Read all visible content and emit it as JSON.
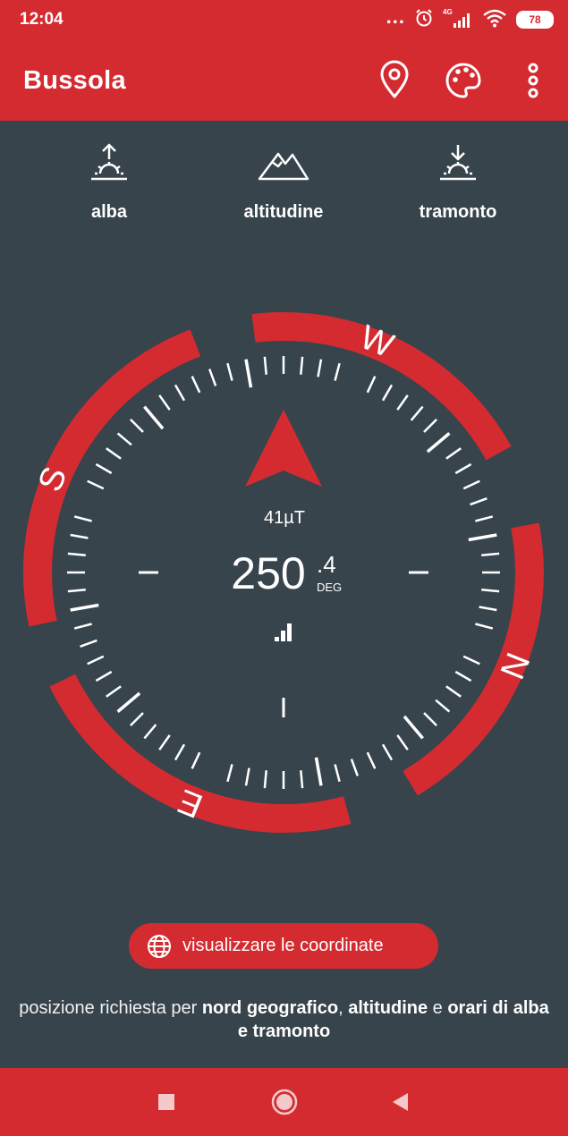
{
  "status_bar": {
    "time": "12:04",
    "network": "4G",
    "battery": "78",
    "icons": [
      "more-dots-icon",
      "alarm-icon",
      "signal-4g-icon",
      "wifi-icon",
      "battery-icon"
    ]
  },
  "app_bar": {
    "title": "Bussola",
    "actions": [
      "location-pin-icon",
      "palette-icon",
      "more-vert-icon"
    ]
  },
  "info_row": [
    {
      "label": "alba",
      "icon": "sunrise-icon"
    },
    {
      "label": "altitudine",
      "icon": "mountain-icon"
    },
    {
      "label": "tramonto",
      "icon": "sunset-icon"
    }
  ],
  "compass": {
    "heading": "250",
    "heading_decimal": ".4",
    "unit": "DEG",
    "field_strength": "41µT",
    "directions": {
      "north": "N",
      "south": "S",
      "east": "E",
      "west": "W"
    },
    "accuracy_icon": "signal-strength-icon",
    "colors": {
      "ring": "#d42b31",
      "needle": "#d42b31",
      "background": "#37444c"
    }
  },
  "coords_button": {
    "label": "visualizzare le coordinate",
    "icon": "globe-icon"
  },
  "note": {
    "part1": "posizione richiesta per ",
    "bold1": "nord geografico",
    "part2": ", ",
    "bold2": "altitudine",
    "part3": " e ",
    "bold3": "orari di alba e tramonto"
  },
  "nav_bar": [
    "recents-square-icon",
    "home-circle-icon",
    "back-triangle-icon"
  ]
}
